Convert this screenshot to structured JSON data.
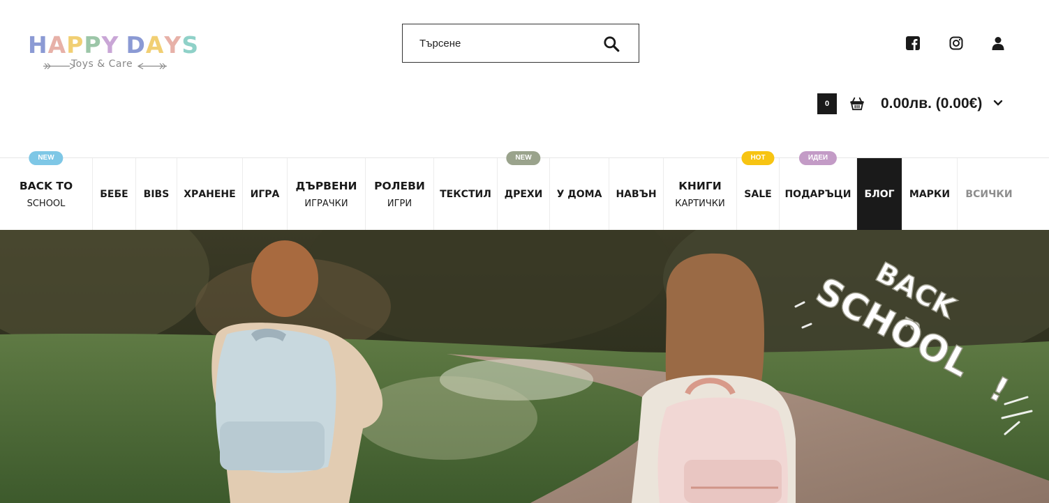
{
  "logo": {
    "title_letters": [
      "H",
      "A",
      "P",
      "P",
      "Y",
      " ",
      "D",
      "A",
      "Y",
      "S"
    ],
    "title_colors": [
      "#8b9ad4",
      "#e7b1a8",
      "#f1cf73",
      "#9cc6a8",
      "#c9a6d6",
      "#ffffff",
      "#8b9ad4",
      "#f1cf73",
      "#e7b1a8",
      "#8fd1c8"
    ],
    "tagline": "Toys & Care"
  },
  "search": {
    "placeholder": "Търсене",
    "icon": "search-icon"
  },
  "social": {
    "facebook_icon": "facebook-icon",
    "instagram_icon": "instagram-icon",
    "account_icon": "user-icon"
  },
  "cart": {
    "count": "0",
    "total": "0.00лв. (0.00€)",
    "icon": "basket-icon"
  },
  "nav": {
    "items": [
      {
        "l1": "BACK TO",
        "l2": "SCHOOL",
        "badge": "NEW"
      },
      {
        "l1": "БЕБЕ"
      },
      {
        "l1": "BIBS"
      },
      {
        "l1": "ХРАНЕНЕ"
      },
      {
        "l1": "ИГРА"
      },
      {
        "l1": "ДЪРВЕНИ",
        "l2": "ИГРАЧКИ"
      },
      {
        "l1": "РОЛЕВИ",
        "l2": "ИГРИ"
      },
      {
        "l1": "ТЕКСТИЛ"
      },
      {
        "l1": "ДРЕХИ",
        "badge": "NEW"
      },
      {
        "l1": "У ДОМА"
      },
      {
        "l1": "НАВЪН"
      },
      {
        "l1": "КНИГИ",
        "l2": "КАРТИЧКИ"
      },
      {
        "l1": "SALE",
        "badge": "HOT"
      },
      {
        "l1": "ПОДАРЪЦИ",
        "badge": "ИДЕИ"
      },
      {
        "l1": "БЛОГ"
      },
      {
        "l1": "МАРКИ"
      },
      {
        "l1": "ВСИЧКИ"
      }
    ],
    "badge_colors": {
      "NEW_blue": "#7ec7e6",
      "NEW_green": "#9aa38c",
      "HOT": "#f7c412",
      "IDEI": "#c39bc6"
    },
    "active_color": "#1a1a1a"
  },
  "hero": {
    "overlay_line1": "BACK",
    "overlay_line2": "TO",
    "overlay_line3": "SCHOOL",
    "exclamation": "!"
  }
}
